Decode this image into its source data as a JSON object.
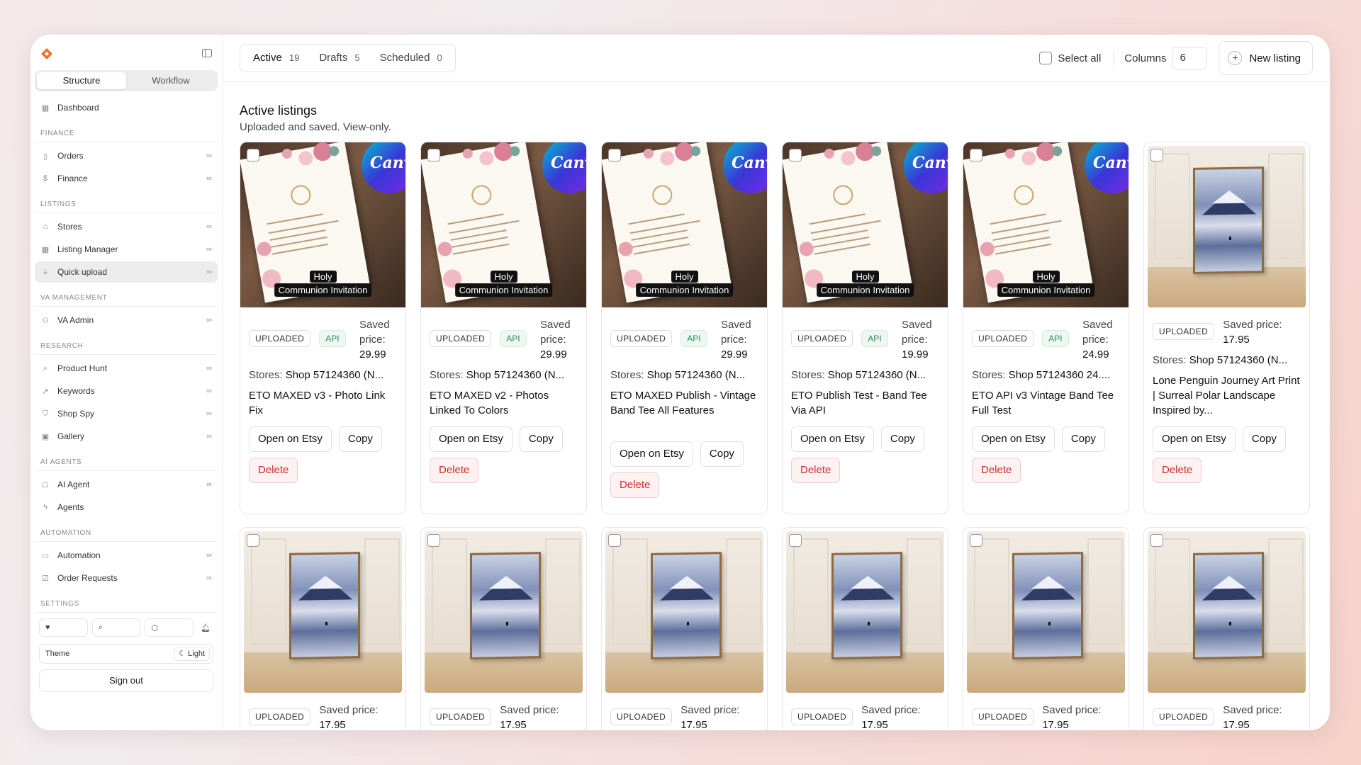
{
  "sidebar": {
    "segments": [
      "Structure",
      "Workflow"
    ],
    "dashboard": "Dashboard",
    "sections": {
      "finance": "FINANCE",
      "listings": "LISTINGS",
      "va": "VA MANAGEMENT",
      "research": "RESEARCH",
      "agents": "AI AGENTS",
      "automation": "AUTOMATION",
      "settings": "SETTINGS"
    },
    "items": {
      "orders": "Orders",
      "finance": "Finance",
      "stores": "Stores",
      "listing_manager": "Listing Manager",
      "quick_upload": "Quick upload",
      "va_admin": "VA Admin",
      "product_hunt": "Product Hunt",
      "keywords": "Keywords",
      "shop_spy": "Shop Spy",
      "gallery": "Gallery",
      "ai_agent": "AI Agent",
      "agents": "Agents",
      "automation": "Automation",
      "order_requests": "Order Requests"
    },
    "theme_label": "Theme",
    "theme_value": "Light",
    "sign_out": "Sign out"
  },
  "topbar": {
    "tabs": [
      {
        "label": "Active",
        "count": "19"
      },
      {
        "label": "Drafts",
        "count": "5"
      },
      {
        "label": "Scheduled",
        "count": "0"
      }
    ],
    "select_all": "Select all",
    "columns_label": "Columns",
    "columns_value": "6",
    "new_listing": "New listing"
  },
  "content": {
    "heading": "Active listings",
    "subheading": "Uploaded and saved. View-only."
  },
  "common": {
    "uploaded": "UPLOADED",
    "api": "API",
    "saved_price_label": "Saved price:",
    "saved": "Saved",
    "price_word": "price:",
    "stores_label": "Stores:",
    "open_on_etsy": "Open on Etsy",
    "copy": "Copy",
    "delete": "Delete",
    "canva": "Canva",
    "holy": "Holy",
    "communion": "Communion Invitation"
  },
  "cards": [
    {
      "price": "29.99",
      "stores": "Shop 57124360 (N...",
      "title": "ETO MAXED v3 - Photo Link Fix"
    },
    {
      "price": "29.99",
      "stores": "Shop 57124360 (N...",
      "title": "ETO MAXED v2 - Photos Linked To Colors"
    },
    {
      "price": "29.99",
      "stores": "Shop 57124360 (N...",
      "title": "ETO MAXED Publish - Vintage Band Tee All Features"
    },
    {
      "price": "19.99",
      "stores": "Shop 57124360 (N...",
      "title": "ETO Publish Test - Band Tee Via API"
    },
    {
      "price": "24.99",
      "stores": "Shop 57124360 24....",
      "title": "ETO API v3 Vintage Band Tee Full Test"
    },
    {
      "price": "17.95",
      "stores": "Shop 57124360 (N...",
      "title": "Lone Penguin Journey Art Print | Surreal Polar Landscape Inspired by..."
    }
  ],
  "row2_price": "17.95"
}
